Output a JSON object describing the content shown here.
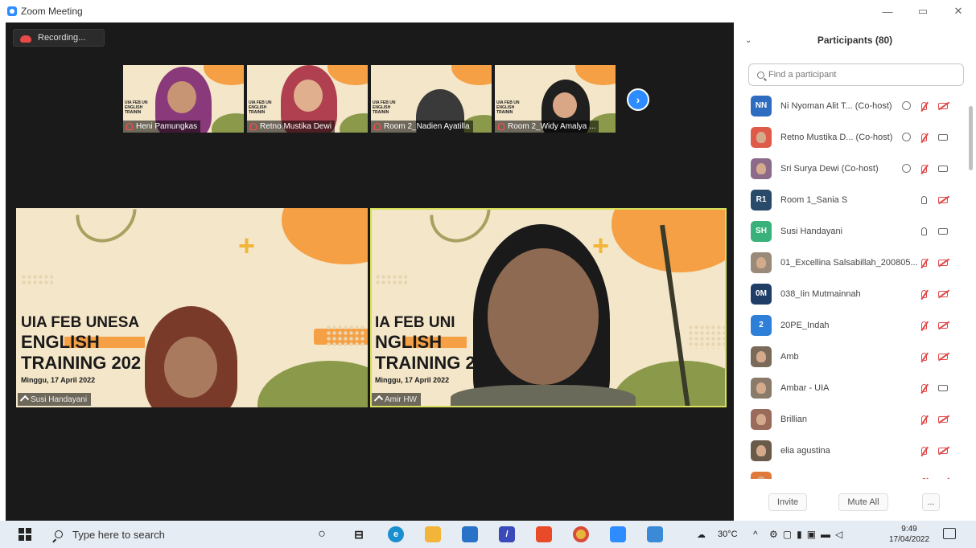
{
  "window": {
    "title": "Zoom Meeting",
    "minimize": "—",
    "restore": "▭",
    "close": "✕"
  },
  "meeting": {
    "recording_label": "Recording...",
    "thumbnails": [
      {
        "name": "Heni Pamungkas"
      },
      {
        "name": "Retno Mustika Dewi"
      },
      {
        "name": "Room 2_Nadien Ayatilla"
      },
      {
        "name": "Room 2_Widy Amalya ..."
      }
    ],
    "next_label": "›",
    "tiles": [
      {
        "name": "Susi Handayani",
        "line1": "UIA FEB UNESA",
        "line2": "ENGLISH",
        "line3": "TRAINING 202",
        "date": "Minggu, 17 April 2022"
      },
      {
        "name": "Amir HW",
        "line1": "IA FEB UNI",
        "line2": "NGLISH",
        "line3": "TRAINING 2",
        "date": "Minggu, 17 April 2022"
      }
    ],
    "mini_slide": {
      "line1": "UIA FEB UN",
      "line2": "ENGLISH",
      "line3": "TRAININ"
    }
  },
  "panel": {
    "title": "Participants (80)",
    "search_placeholder": "Find a participant",
    "participants": [
      {
        "initials": "NN",
        "color": "#2e6cc0",
        "name": "Ni Nyoman Alit T... (Co-host)",
        "share": true,
        "mic": "off",
        "video": "off"
      },
      {
        "initials": "",
        "color": "#e05a4a",
        "name": "Retno Mustika D... (Co-host)",
        "share": true,
        "mic": "off",
        "video": "on"
      },
      {
        "initials": "",
        "color": "#8c6a8a",
        "name": "Sri Surya Dewi (Co-host)",
        "share": true,
        "mic": "off",
        "video": "on"
      },
      {
        "initials": "R1",
        "color": "#2a4a6a",
        "name": "Room 1_Sania S",
        "share": false,
        "mic": "on",
        "video": "off"
      },
      {
        "initials": "SH",
        "color": "#3ab07a",
        "name": "Susi Handayani",
        "share": false,
        "mic": "on",
        "video": "on"
      },
      {
        "initials": "",
        "color": "#9a8a7a",
        "name": "01_Excellina Salsabillah_200805...",
        "share": false,
        "mic": "off",
        "video": "off"
      },
      {
        "initials": "0M",
        "color": "#1f3d66",
        "name": "038_Iin Mutmainnah",
        "share": false,
        "mic": "off",
        "video": "off"
      },
      {
        "initials": "2",
        "color": "#2d7fd8",
        "name": "20PE_Indah",
        "share": false,
        "mic": "off",
        "video": "off"
      },
      {
        "initials": "",
        "color": "#7a6a5a",
        "name": "Amb",
        "share": false,
        "mic": "off",
        "video": "off"
      },
      {
        "initials": "",
        "color": "#8a7a6a",
        "name": "Ambar - UIA",
        "share": false,
        "mic": "off",
        "video": "on"
      },
      {
        "initials": "",
        "color": "#9a6a5a",
        "name": "Brillian",
        "share": false,
        "mic": "off",
        "video": "off"
      },
      {
        "initials": "",
        "color": "#6a5a4a",
        "name": "elia agustina",
        "share": false,
        "mic": "off",
        "video": "off"
      },
      {
        "initials": "",
        "color": "#e07a3a",
        "name": "",
        "share": false,
        "mic": "off",
        "video": "off"
      }
    ],
    "invite_label": "Invite",
    "mute_all_label": "Mute All",
    "more_label": "..."
  },
  "taskbar": {
    "search_text": "Type here to search",
    "weather": "30°C",
    "time": "9:49",
    "date": "17/04/2022"
  }
}
